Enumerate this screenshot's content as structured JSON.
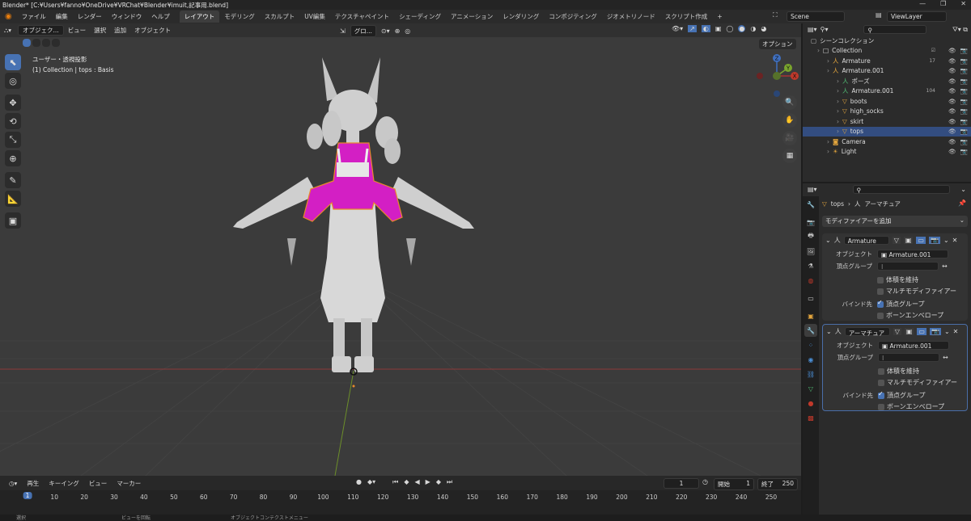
{
  "window": {
    "title": "Blender* [C:¥Users¥fanno¥OneDrive¥VRChat¥Blender¥imuit,記事用.blend]",
    "minimize": "—",
    "maximize": "❐",
    "close": "✕"
  },
  "menu": [
    "ファイル",
    "編集",
    "レンダー",
    "ウィンドウ",
    "ヘルプ"
  ],
  "workspaces": [
    "レイアウト",
    "モデリング",
    "スカルプト",
    "UV編集",
    "テクスチャペイント",
    "シェーディング",
    "アニメーション",
    "レンダリング",
    "コンポジティング",
    "ジオメトリノード",
    "スクリプト作成"
  ],
  "workspace_add": "+",
  "scene": {
    "label": "Scene",
    "viewlayer": "ViewLayer"
  },
  "viewport_header": {
    "mode": "オブジェク...",
    "items": [
      "ビュー",
      "選択",
      "追加",
      "オブジェクト"
    ],
    "transform": "グロ...",
    "options": "オプション"
  },
  "viewport_info": {
    "line1": "ユーザー・透視投影",
    "line2": "(1) Collection | tops : Basis"
  },
  "gizmo": {
    "z": "Z",
    "y": "Y",
    "x": "X"
  },
  "outliner": {
    "title": "シーンコレクション",
    "rows": [
      {
        "name": "Collection",
        "indent": 0,
        "icon": "□",
        "color": "#e0e0e0",
        "selected": false,
        "extra": "☑"
      },
      {
        "name": "Armature",
        "indent": 1,
        "icon": "人",
        "color": "#e3a53d",
        "selected": false,
        "extra": "17"
      },
      {
        "name": "Armature.001",
        "indent": 1,
        "icon": "人",
        "color": "#e3a53d",
        "selected": false,
        "extra": ""
      },
      {
        "name": "ポーズ",
        "indent": 2,
        "icon": "人",
        "color": "#4fb872",
        "selected": false,
        "extra": ""
      },
      {
        "name": "Armature.001",
        "indent": 2,
        "icon": "人",
        "color": "#4fb872",
        "selected": false,
        "extra": "104"
      },
      {
        "name": "boots",
        "indent": 2,
        "icon": "▽",
        "color": "#e3a53d",
        "selected": false,
        "extra": ""
      },
      {
        "name": "high_socks",
        "indent": 2,
        "icon": "▽",
        "color": "#e3a53d",
        "selected": false,
        "extra": ""
      },
      {
        "name": "skirt",
        "indent": 2,
        "icon": "▽",
        "color": "#e3a53d",
        "selected": false,
        "extra": ""
      },
      {
        "name": "tops",
        "indent": 2,
        "icon": "▽",
        "color": "#e3a53d",
        "selected": true,
        "extra": ""
      },
      {
        "name": "Camera",
        "indent": 1,
        "icon": "◙",
        "color": "#e3a53d",
        "selected": false,
        "extra": ""
      },
      {
        "name": "Light",
        "indent": 1,
        "icon": "☀",
        "color": "#e3a53d",
        "selected": false,
        "extra": ""
      }
    ]
  },
  "props": {
    "breadcrumb_obj": "tops",
    "breadcrumb_sep": "›",
    "breadcrumb_mod": "アーマチュア",
    "add_modifier": "モディファイアーを追加",
    "modifiers": [
      {
        "name": "Armature",
        "object_label": "オブジェクト",
        "object": "Armature.001",
        "vgroup_label": "頂点グループ",
        "preserve_volume": "体積を維持",
        "multi_modifier": "マルチモディファイアー",
        "bind_label": "バインド先",
        "bind_vgroups": "頂点グループ",
        "bind_envelopes": "ボーンエンベロープ"
      },
      {
        "name": "アーマチュア",
        "object_label": "オブジェクト",
        "object": "Armature.001",
        "vgroup_label": "頂点グループ",
        "preserve_volume": "体積を維持",
        "multi_modifier": "マルチモディファイアー",
        "bind_label": "バインド先",
        "bind_vgroups": "頂点グループ",
        "bind_envelopes": "ボーンエンベロープ"
      }
    ]
  },
  "timeline": {
    "menus": [
      "再生",
      "キーイング",
      "ビュー",
      "マーカー"
    ],
    "current_frame": "1",
    "start_label": "開始",
    "start": "1",
    "end_label": "終了",
    "end": "250",
    "ticks": [
      "1",
      "10",
      "20",
      "30",
      "40",
      "50",
      "60",
      "70",
      "80",
      "90",
      "100",
      "110",
      "120",
      "130",
      "140",
      "150",
      "160",
      "170",
      "180",
      "190",
      "200",
      "210",
      "220",
      "230",
      "240",
      "250"
    ],
    "playhead": "1"
  },
  "status": {
    "left": "選択",
    "mid": "ビューを回転",
    "right": "オブジェクトコンテクストメニュー"
  },
  "colors": {
    "accent": "#4772b3",
    "selection": "#334d80",
    "tops": "#d31fc4",
    "outline": "#e8892a"
  }
}
